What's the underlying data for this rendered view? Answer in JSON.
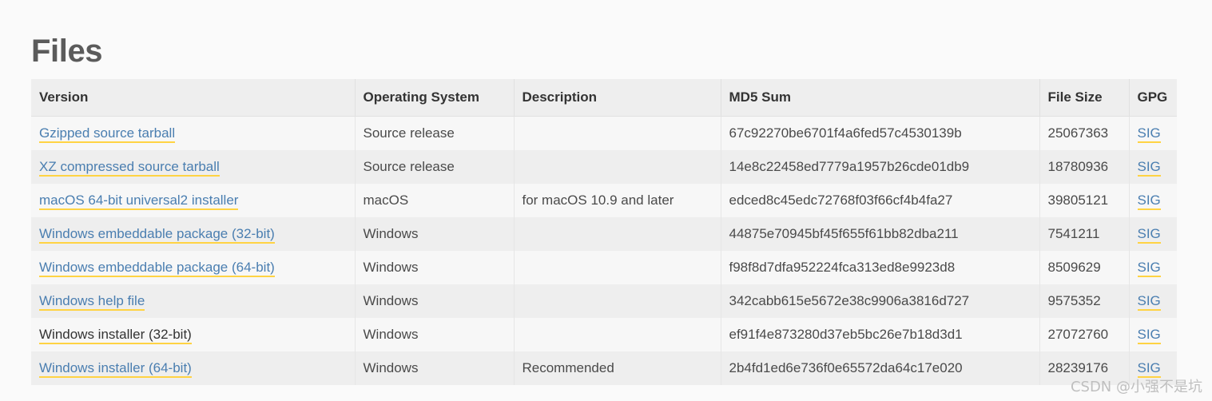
{
  "page": {
    "title": "Files",
    "watermark": "CSDN @小强不是坑"
  },
  "colors": {
    "link": "#4a7eb0",
    "link_underline": "#ffd343",
    "heading": "#5b5b5b",
    "header_bg": "#eeeeee",
    "row_odd_bg": "#f7f7f7",
    "row_even_bg": "#eeeeee",
    "page_bg": "#fafafa"
  },
  "table": {
    "columns": [
      {
        "key": "version",
        "label": "Version"
      },
      {
        "key": "os",
        "label": "Operating System"
      },
      {
        "key": "description",
        "label": "Description"
      },
      {
        "key": "md5",
        "label": "MD5 Sum"
      },
      {
        "key": "size",
        "label": "File Size"
      },
      {
        "key": "gpg",
        "label": "GPG"
      }
    ],
    "rows": [
      {
        "version": "Gzipped source tarball",
        "version_visited": false,
        "os": "Source release",
        "description": "",
        "md5": "67c92270be6701f4a6fed57c4530139b",
        "size": "25067363",
        "gpg": "SIG"
      },
      {
        "version": "XZ compressed source tarball",
        "version_visited": false,
        "os": "Source release",
        "description": "",
        "md5": "14e8c22458ed7779a1957b26cde01db9",
        "size": "18780936",
        "gpg": "SIG"
      },
      {
        "version": "macOS 64-bit universal2 installer",
        "version_visited": false,
        "os": "macOS",
        "description": "for macOS 10.9 and later",
        "md5": "edced8c45edc72768f03f66cf4b4fa27",
        "size": "39805121",
        "gpg": "SIG"
      },
      {
        "version": "Windows embeddable package (32-bit)",
        "version_visited": false,
        "os": "Windows",
        "description": "",
        "md5": "44875e70945bf45f655f61bb82dba211",
        "size": "7541211",
        "gpg": "SIG"
      },
      {
        "version": "Windows embeddable package (64-bit)",
        "version_visited": false,
        "os": "Windows",
        "description": "",
        "md5": "f98f8d7dfa952224fca313ed8e9923d8",
        "size": "8509629",
        "gpg": "SIG"
      },
      {
        "version": "Windows help file",
        "version_visited": false,
        "os": "Windows",
        "description": "",
        "md5": "342cabb615e5672e38c9906a3816d727",
        "size": "9575352",
        "gpg": "SIG"
      },
      {
        "version": "Windows installer (32-bit)",
        "version_visited": true,
        "os": "Windows",
        "description": "",
        "md5": "ef91f4e873280d37eb5bc26e7b18d3d1",
        "size": "27072760",
        "gpg": "SIG"
      },
      {
        "version": "Windows installer (64-bit)",
        "version_visited": false,
        "os": "Windows",
        "description": "Recommended",
        "md5": "2b4fd1ed6e736f0e65572da64c17e020",
        "size": "28239176",
        "gpg": "SIG"
      }
    ]
  }
}
